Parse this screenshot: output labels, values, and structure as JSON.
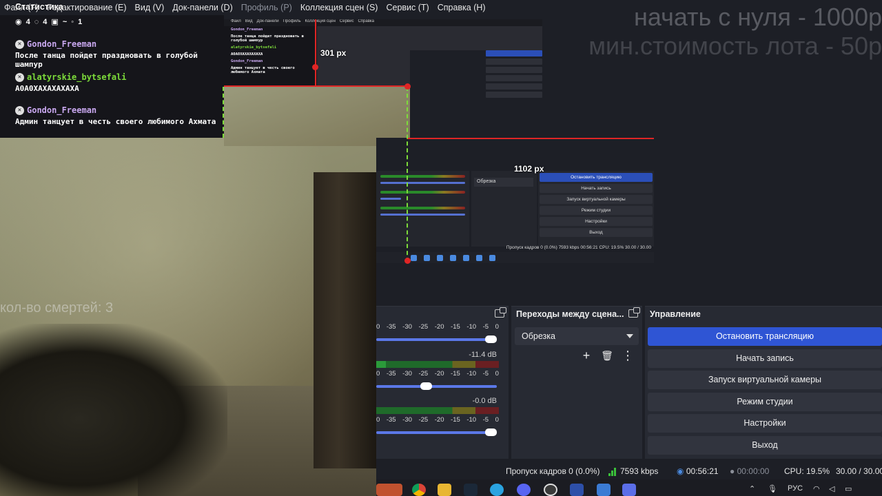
{
  "menu": {
    "items": [
      {
        "label": "Файл (F)",
        "dim": false
      },
      {
        "label": "Редактирование (E)",
        "dim": false
      },
      {
        "label": "Вид (V)",
        "dim": false
      },
      {
        "label": "Док-панели (D)",
        "dim": false
      },
      {
        "label": "Профиль (P)",
        "dim": true
      },
      {
        "label": "Коллекция сцен (S)",
        "dim": false
      },
      {
        "label": "Сервис (T)",
        "dim": false
      },
      {
        "label": "Справка (H)",
        "dim": false
      }
    ],
    "overlay_title": "Статистика"
  },
  "chat": {
    "stats": {
      "viewers": "4",
      "chatters": "4",
      "bits": "~",
      "messages": "1"
    },
    "messages": [
      {
        "user": "Gondon_Freeman",
        "user_color": "#c9a8f0",
        "text": "После танца пойдет праздновать в голубой шампур"
      },
      {
        "user": "alatyrskie_bytsefali",
        "user_color": "#7ddc3a",
        "text": "А0А0ХАХАХАХАХА"
      },
      {
        "user": "Gondon_Freeman",
        "user_color": "#c9a8f0",
        "text": "Админ танцует в честь своего любимого Ахмата"
      }
    ]
  },
  "overlay": {
    "line1": "начать с нуля - 1000р",
    "line2": "мин.стоимость лота - 50р",
    "deaths": "кол-во смертей: 3"
  },
  "nested_preview": {
    "px_label_1": "301 px",
    "px_label_2": "1102 px",
    "transitions_header": "Переходы между сце...",
    "control_header": "Управление",
    "db_values": [
      "-11.4 dB",
      "-0.0 dB"
    ],
    "status": "Пропуск кадров 0 (0.0%)   7593 kbps   00:56:21   CPU: 19.5%   30.00 / 30.00"
  },
  "mixer": {
    "channels": [
      {
        "db": "",
        "ticks": [
          "0",
          "-35",
          "-30",
          "-25",
          "-20",
          "-15",
          "-10",
          "-5",
          "0"
        ],
        "volume": 1.0
      },
      {
        "db": "-11.4 dB",
        "ticks": [
          "0",
          "-35",
          "-30",
          "-25",
          "-20",
          "-15",
          "-10",
          "-5",
          "0"
        ],
        "volume": 0.42
      },
      {
        "db": "-0.0 dB",
        "ticks": [
          "0",
          "-35",
          "-30",
          "-25",
          "-20",
          "-15",
          "-10",
          "-5",
          "0"
        ],
        "volume": 1.0
      }
    ]
  },
  "transitions": {
    "title": "Переходы между сцена...",
    "selected": "Обрезка",
    "add_label": "+",
    "remove_label": "🗑",
    "more_label": "⋮"
  },
  "controls": {
    "title": "Управление",
    "buttons": [
      {
        "label": "Остановить трансляцию",
        "primary": true
      },
      {
        "label": "Начать запись",
        "primary": false
      },
      {
        "label": "Запуск виртуальной камеры",
        "primary": false
      },
      {
        "label": "Режим студии",
        "primary": false
      },
      {
        "label": "Настройки",
        "primary": false
      },
      {
        "label": "Выход",
        "primary": false
      }
    ]
  },
  "status": {
    "dropped_frames": "Пропуск кадров 0 (0.0%)",
    "bitrate": "7593 kbps",
    "stream_time": "00:56:21",
    "record_time": "00:00:00",
    "cpu": "CPU: 19.5%",
    "fps": "30.00 / 30.00"
  },
  "taskbar": {
    "language": "РУС",
    "colors": {
      "accent": "#2f55d4"
    }
  }
}
